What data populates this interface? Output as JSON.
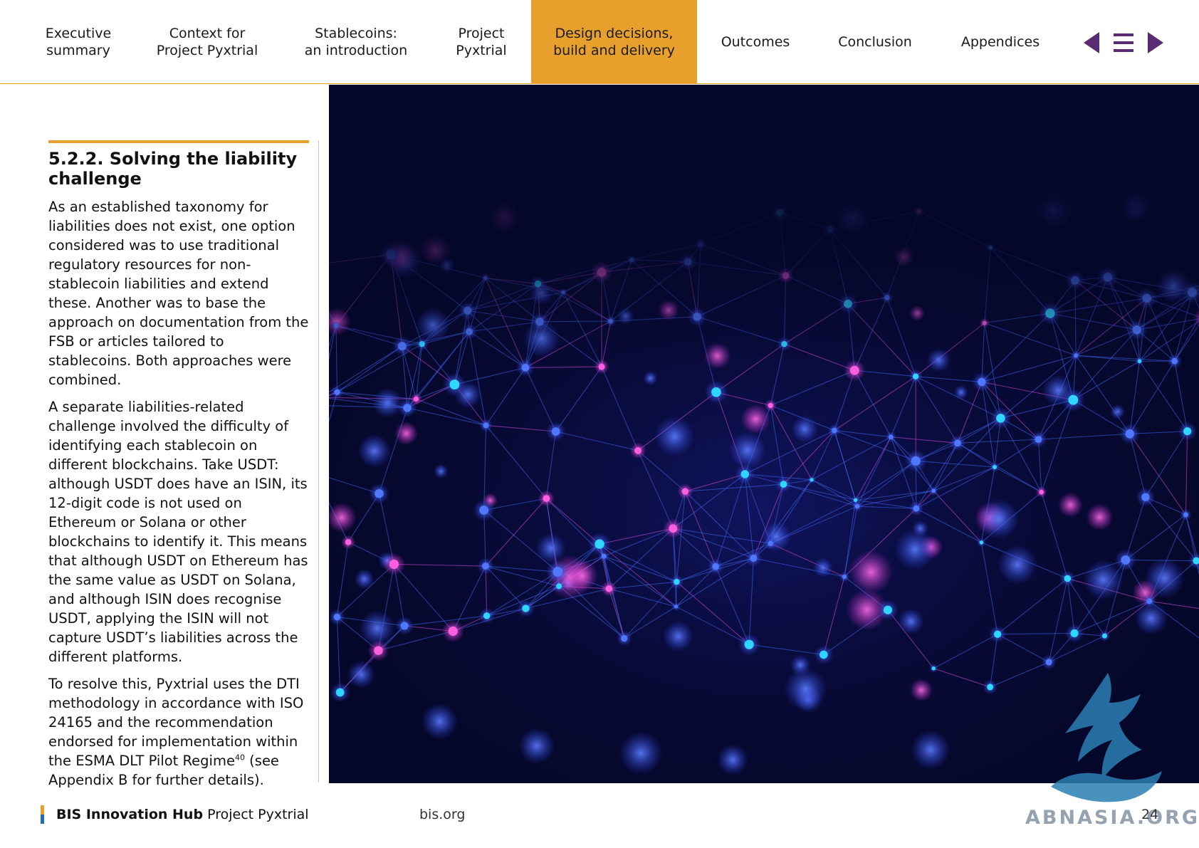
{
  "nav": {
    "items": [
      {
        "label": "Executive\nsummary",
        "active": false
      },
      {
        "label": "Context for\nProject Pyxtrial",
        "active": false
      },
      {
        "label": "Stablecoins:\nan introduction",
        "active": false
      },
      {
        "label": "Project\nPyxtrial",
        "active": false
      },
      {
        "label": "Design decisions,\nbuild and delivery",
        "active": true
      },
      {
        "label": "Outcomes",
        "active": false
      },
      {
        "label": "Conclusion",
        "active": false
      },
      {
        "label": "Appendices",
        "active": false
      }
    ],
    "controls": {
      "prev_icon": "triangle-left-icon",
      "menu_icon": "hamburger-menu-icon",
      "next_icon": "triangle-right-icon"
    }
  },
  "section": {
    "title": "5.2.2. Solving the liability challenge",
    "paragraphs": [
      "As an established taxonomy for liabilities does not exist, one option considered was to use traditional regulatory resources for non-stablecoin liabilities and extend these. Another was to base the approach on documentation from the FSB or articles tailored to stablecoins. Both approaches were combined.",
      "A separate liabilities-related challenge involved the difficulty of identifying each stablecoin on different blockchains. Take USDT: although USDT does have an ISIN, its 12-digit code is not used on Ethereum or Solana or other blockchains to identify it. This means that although USDT on Ethereum has the same value as USDT on Solana, and although ISIN does recognise USDT, applying the ISIN will not capture USDT’s liabilities across the different platforms.",
      "To resolve this, Pyxtrial uses the DTI methodology in accordance with ISO 24165 and the recommendation endorsed for implementation within the ESMA DLT Pilot Regime"
    ],
    "footnote_ref": "40",
    "paragraph_tail": "(see Appendix B for further details)."
  },
  "footer": {
    "org_bold": "BIS Innovation Hub",
    "org_rest": "Project Pyxtrial",
    "url": "bis.org",
    "page_number": "24"
  },
  "watermark": {
    "text": "ABNASIA.ORG"
  },
  "colors": {
    "accent": "#e8a02d",
    "nav_arrow": "#5a2a72",
    "image_bg": "#05072a",
    "node_blue": "#3a6bff",
    "node_cyan": "#22d3ff",
    "node_pink": "#ff4fd8"
  }
}
